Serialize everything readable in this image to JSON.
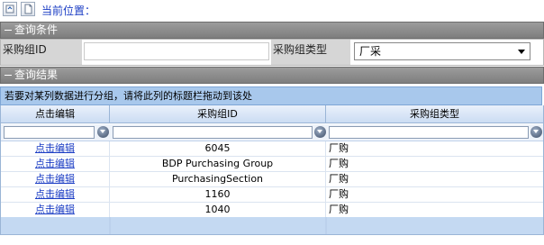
{
  "toolbar": {
    "icons": [
      "refresh-icon",
      "document-icon"
    ],
    "location_label": "当前位置："
  },
  "query_panel": {
    "title": "查询条件",
    "fields": [
      {
        "label": "采购组ID",
        "value": ""
      },
      {
        "label": "采购组类型",
        "value": "厂采"
      }
    ]
  },
  "result_panel": {
    "title": "查询结果",
    "group_hint": "若要对某列数据进行分组，请将此列的标题栏拖动到该处",
    "columns": [
      "点击编辑",
      "采购组ID",
      "采购组类型"
    ],
    "rows": [
      {
        "edit": "点击编辑",
        "id": "6045",
        "type": "厂购"
      },
      {
        "edit": "点击编辑",
        "id": "BDP Purchasing Group",
        "type": "厂购"
      },
      {
        "edit": "点击编辑",
        "id": "PurchasingSection",
        "type": "厂购"
      },
      {
        "edit": "点击编辑",
        "id": "1160",
        "type": "厂购"
      },
      {
        "edit": "点击编辑",
        "id": "1040",
        "type": "厂购"
      }
    ]
  }
}
